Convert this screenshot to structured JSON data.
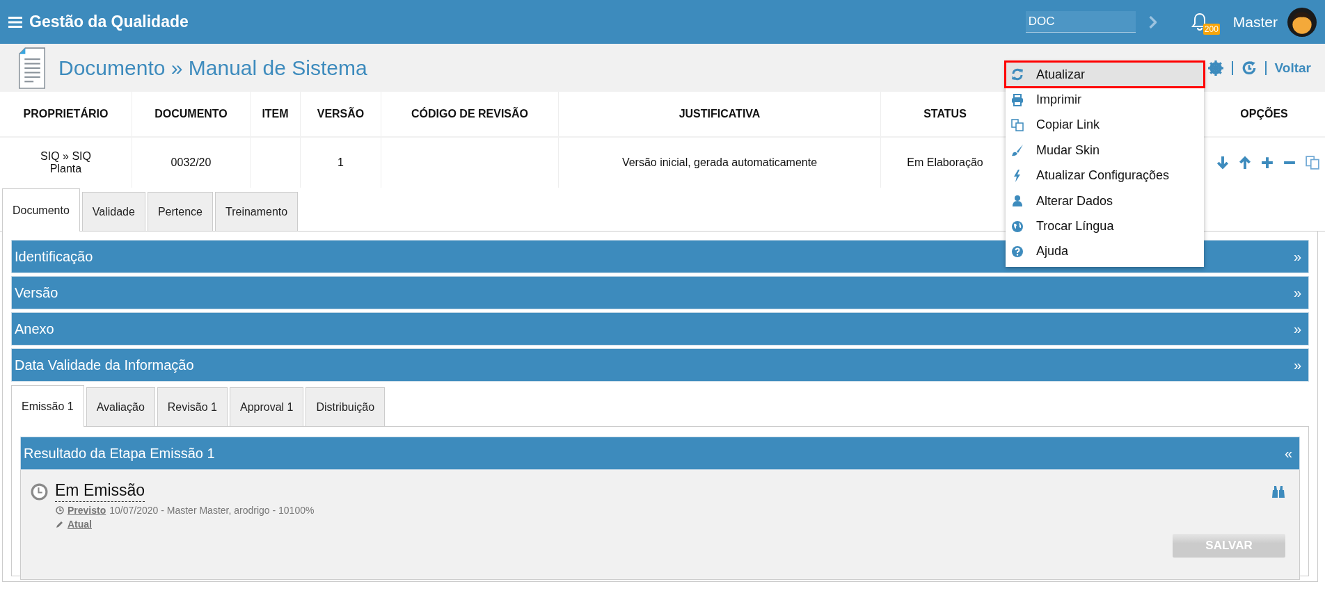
{
  "header": {
    "title": "Gestão da Qualidade",
    "search": {
      "value": "DOC"
    },
    "notifications": "200",
    "user": "Master"
  },
  "page": {
    "title": "Documento » Manual de Sistema",
    "back": "Voltar"
  },
  "table": {
    "columns": [
      "PROPRIETÁRIO",
      "DOCUMENTO",
      "ITEM",
      "VERSÃO",
      "CÓDIGO DE REVISÃO",
      "JUSTIFICATIVA",
      "STATUS",
      "OPÇÕES"
    ],
    "row": {
      "proprietario": "SIQ » SIQ Planta",
      "documento": "0032/20",
      "versao": "1",
      "justificativa": "Versão inicial, gerada automaticamente",
      "status": "Em Elaboração"
    }
  },
  "tabs": [
    {
      "label": "Documento",
      "selected": true
    },
    {
      "label": "Validade",
      "selected": false
    },
    {
      "label": "Pertence",
      "selected": false
    },
    {
      "label": "Treinamento",
      "selected": false
    }
  ],
  "sections": [
    {
      "title": "Identificação",
      "toggle": "»"
    },
    {
      "title": "Versão",
      "toggle": "»"
    },
    {
      "title": "Anexo",
      "toggle": "»"
    },
    {
      "title": "Data Validade da Informação",
      "toggle": "»"
    }
  ],
  "stage_tabs": [
    {
      "label": "Emissão 1",
      "selected": true
    },
    {
      "label": "Avaliação",
      "selected": false
    },
    {
      "label": "Revisão 1",
      "selected": false
    },
    {
      "label": "Approval 1",
      "selected": false
    },
    {
      "label": "Distribuição",
      "selected": false
    }
  ],
  "result": {
    "title": "Resultado da Etapa Emissão 1",
    "toggle": "«",
    "status": "Em Emissão",
    "planned_label": "Previsto",
    "planned_text": "10/07/2020 - Master Master, arodrigo - 10100%",
    "current_label": "Atual",
    "save_button": {
      "label": "SALVAR",
      "disabled": true
    }
  },
  "menu": [
    {
      "label": "Atualizar",
      "selected": true
    },
    {
      "label": "Imprimir",
      "selected": false
    },
    {
      "label": "Copiar Link",
      "selected": false
    },
    {
      "label": "Mudar Skin",
      "selected": false
    },
    {
      "label": "Atualizar Configurações",
      "selected": false
    },
    {
      "label": "Alterar Dados",
      "selected": false
    },
    {
      "label": "Trocar Língua",
      "selected": false
    },
    {
      "label": "Ajuda",
      "selected": false
    }
  ]
}
